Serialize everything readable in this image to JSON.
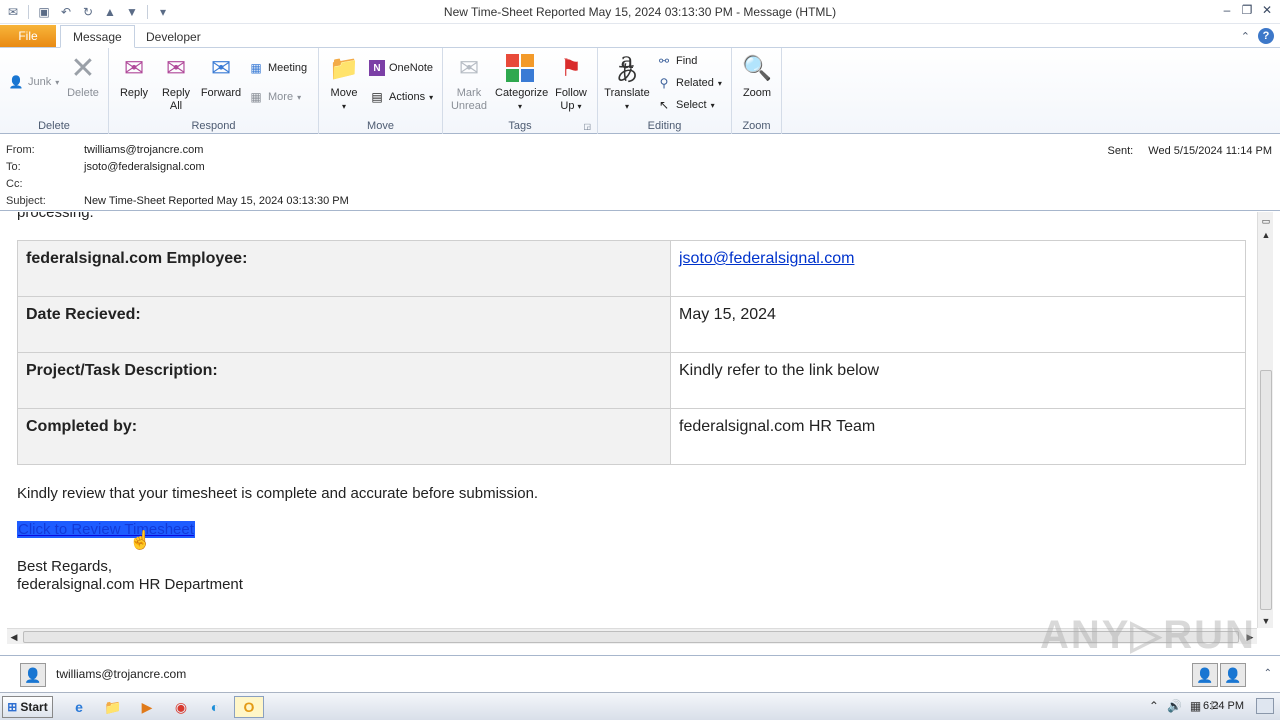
{
  "window": {
    "title": "New Time-Sheet Reported May 15, 2024 03:13:30 PM  -  Message (HTML)"
  },
  "tabs": {
    "file": "File",
    "message": "Message",
    "developer": "Developer"
  },
  "ribbon": {
    "delete_group": {
      "label": "Delete",
      "junk": "Junk",
      "delete": "Delete"
    },
    "respond_group": {
      "label": "Respond",
      "reply": "Reply",
      "reply_all_1": "Reply",
      "reply_all_2": "All",
      "forward": "Forward",
      "meeting": "Meeting",
      "more": "More"
    },
    "move_group": {
      "label": "Move",
      "move": "Move",
      "onenote": "OneNote",
      "actions": "Actions"
    },
    "tags_group": {
      "label": "Tags",
      "mark_unread_1": "Mark",
      "mark_unread_2": "Unread",
      "categorize": "Categorize",
      "follow_up_1": "Follow",
      "follow_up_2": "Up"
    },
    "editing_group": {
      "label": "Editing",
      "translate": "Translate",
      "find": "Find",
      "related": "Related",
      "select": "Select"
    },
    "zoom_group": {
      "label": "Zoom",
      "zoom": "Zoom"
    }
  },
  "header": {
    "from_label": "From:",
    "from": "twilliams@trojancre.com",
    "to_label": "To:",
    "to": "jsoto@federalsignal.com",
    "cc_label": "Cc:",
    "cc": "",
    "subject_label": "Subject:",
    "subject": "New Time-Sheet Reported May 15, 2024 03:13:30 PM",
    "sent_label": "Sent:",
    "sent": "Wed 5/15/2024 11:14 PM"
  },
  "body": {
    "partial_text": "processing.",
    "rows": [
      {
        "key": "federalsignal.com Employee:",
        "value": "jsoto@federalsignal.com",
        "link": true
      },
      {
        "key": "Date Recieved:",
        "value": "May 15, 2024",
        "link": false
      },
      {
        "key": "Project/Task Description:",
        "value": "Kindly refer to the link below",
        "link": false
      },
      {
        "key": "Completed by:",
        "value": "federalsignal.com HR Team",
        "link": false
      }
    ],
    "note": "Kindly review that your timesheet is complete and accurate before submission.",
    "review_link": "Click to Review Timesheet",
    "regards_1": "Best Regards,",
    "regards_2": "federalsignal.com HR Department"
  },
  "people_pane": {
    "name": "twilliams@trojancre.com"
  },
  "watermark": "ANY▷RUN",
  "taskbar": {
    "start": "Start",
    "clock": "6:24 PM"
  },
  "colors": {
    "file_tab": "#e98a13",
    "link": "#0033cc",
    "selection": "#1e5cff"
  }
}
